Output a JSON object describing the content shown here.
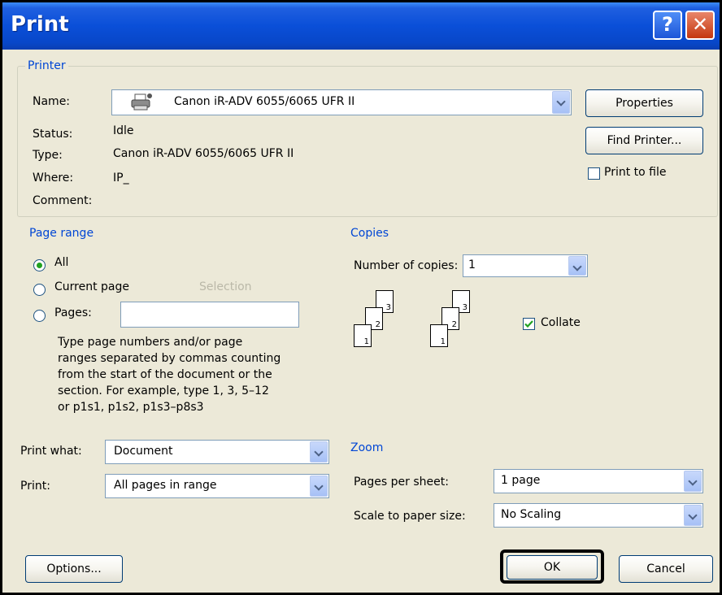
{
  "window": {
    "title": "Print",
    "help_glyph": "?",
    "close_glyph": "✕"
  },
  "printer": {
    "group_label": "Printer",
    "name_label": "Name:",
    "name_value": "Canon iR-ADV 6055/6065 UFR II",
    "status_label": "Status:",
    "status_value": "Idle",
    "type_label": "Type:",
    "type_value": "Canon iR-ADV 6055/6065 UFR II",
    "where_label": "Where:",
    "where_value": "IP_",
    "comment_label": "Comment:",
    "properties_button": "Properties",
    "find_printer_button": "Find Printer...",
    "print_to_file_label": "Print to file",
    "print_to_file_checked": false
  },
  "page_range": {
    "group_label": "Page range",
    "all_label": "All",
    "current_page_label": "Current page",
    "selection_label": "Selection",
    "pages_label": "Pages:",
    "pages_value": "",
    "selected": "all",
    "help_lines": [
      "Type page numbers and/or page",
      "ranges separated by commas counting",
      "from the start of the document or the",
      "section. For example, type 1, 3, 5–12",
      "or p1s1, p1s2, p1s3–p8s3"
    ]
  },
  "copies": {
    "group_label": "Copies",
    "number_label": "Number of copies:",
    "number_value": "1",
    "collate_label": "Collate",
    "collate_checked": true,
    "page_numbers": [
      "1",
      "2",
      "3"
    ]
  },
  "print_what": {
    "label": "Print what:",
    "value": "Document"
  },
  "print": {
    "label": "Print:",
    "value": "All pages in range"
  },
  "zoom": {
    "group_label": "Zoom",
    "pages_per_sheet_label": "Pages per sheet:",
    "pages_per_sheet_value": "1 page",
    "scale_label": "Scale to paper size:",
    "scale_value": "No Scaling"
  },
  "footer": {
    "options_button": "Options...",
    "ok_button": "OK",
    "cancel_button": "Cancel"
  }
}
